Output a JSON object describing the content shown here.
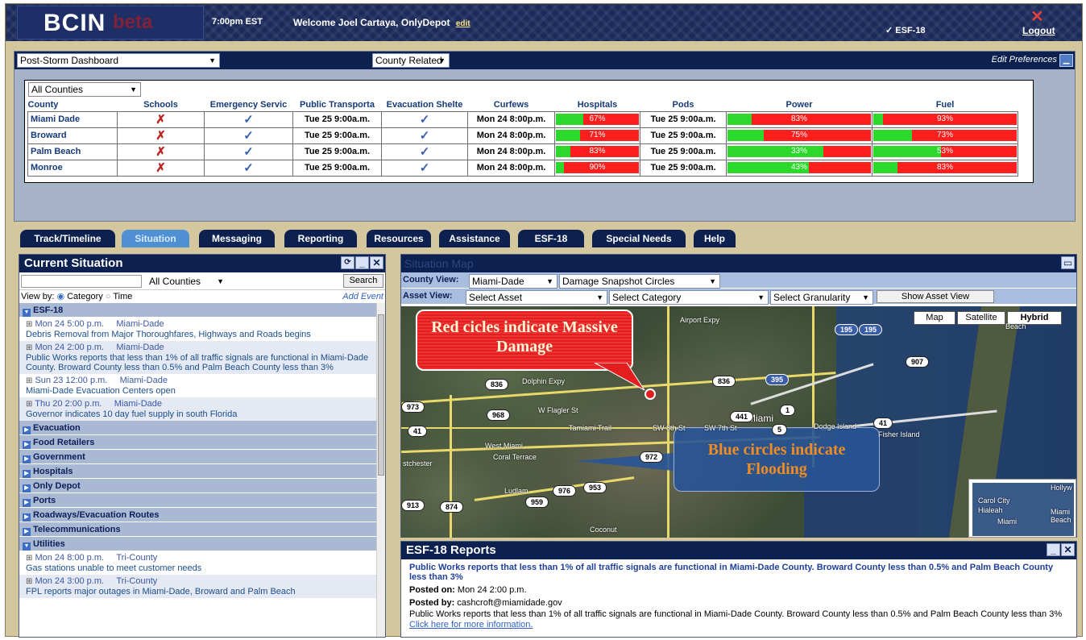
{
  "header": {
    "logo": "BCIN",
    "logo_suffix": "beta",
    "time": "7:00pm EST",
    "welcome": "Welcome Joel Cartaya, OnlyDepot",
    "edit_link": "edit",
    "esf": "✓ ESF-18",
    "logout": "Logout"
  },
  "dashboard": {
    "view_select": "Post-Storm Dashboard",
    "related_select": "County Related",
    "edit_preferences": "Edit Preferences",
    "county_filter": "All Counties",
    "columns": [
      "County",
      "Schools",
      "Emergency Servic",
      "Public Transporta",
      "Evacuation Shelte",
      "Curfews",
      "Hospitals",
      "Pods",
      "Power",
      "Fuel"
    ],
    "rows": [
      {
        "county": "Miami Dade",
        "schools": "✗",
        "emergency": "✓",
        "transport": "Tue 25 9:00a.m.",
        "shelter": "✓",
        "curfew": "Mon 24 8:00p.m.",
        "hospitals": "67%",
        "hospitals_pct": 33,
        "pods": "Tue 25 9:00a.m.",
        "power": "83%",
        "power_pct": 17,
        "fuel": "93%",
        "fuel_pct": 7
      },
      {
        "county": "Broward",
        "schools": "✗",
        "emergency": "✓",
        "transport": "Tue 25 9:00a.m.",
        "shelter": "✓",
        "curfew": "Mon 24 8:00p.m.",
        "hospitals": "71%",
        "hospitals_pct": 29,
        "pods": "Tue 25 9:00a.m.",
        "power": "75%",
        "power_pct": 25,
        "fuel": "73%",
        "fuel_pct": 27
      },
      {
        "county": "Palm Beach",
        "schools": "✗",
        "emergency": "✓",
        "transport": "Tue 25 9:00a.m.",
        "shelter": "✓",
        "curfew": "Mon 24 8:00p.m.",
        "hospitals": "83%",
        "hospitals_pct": 17,
        "pods": "Tue 25 9:00a.m.",
        "power": "33%",
        "power_pct": 67,
        "fuel": "53%",
        "fuel_pct": 47
      },
      {
        "county": "Monroe",
        "schools": "✗",
        "emergency": "✓",
        "transport": "Tue 25 9:00a.m.",
        "shelter": "✓",
        "curfew": "Mon 24 8:00p.m.",
        "hospitals": "90%",
        "hospitals_pct": 10,
        "pods": "Tue 25 9:00a.m.",
        "power": "43%",
        "power_pct": 57,
        "fuel": "83%",
        "fuel_pct": 17
      }
    ]
  },
  "tabs": [
    "Track/Timeline",
    "Situation",
    "Messaging",
    "Reporting",
    "Resources",
    "Assistance",
    "ESF-18",
    "Special Needs",
    "Help"
  ],
  "situation": {
    "title": "Current Situation",
    "county_select": "All Counties",
    "search": "Search",
    "view_by": "View by:",
    "opt_category": "Category",
    "opt_time": "Time",
    "add_event": "Add Event",
    "esf_group": "ESF-18",
    "esf_entries": [
      {
        "time": "Mon 24 5:00 p.m.",
        "loc": "Miami-Dade",
        "text": "Debris Removal from Major Thoroughfares, Highways and Roads begins"
      },
      {
        "time": "Mon 24 2:00 p.m.",
        "loc": "Miami-Dade",
        "text": "Public Works reports that less than 1% of all traffic signals are functional in Miami-Dade County. Broward County less than 0.5% and Palm Beach County less than 3%"
      },
      {
        "time": "Sun 23 12:00 p.m.",
        "loc": "Miami-Dade",
        "text": "Miami-Dade Evacuation Centers open"
      },
      {
        "time": "Thu 20 2:00 p.m.",
        "loc": "Miami-Dade",
        "text": "Governor indicates 10 day fuel supply in south Florida"
      }
    ],
    "categories": [
      "Evacuation",
      "Food Retailers",
      "Government",
      "Hospitals",
      "Only Depot",
      "Ports",
      "Roadways/Evacuation Routes",
      "Telecommunications"
    ],
    "utilities_group": "Utilities",
    "util_entries": [
      {
        "time": "Mon 24 8:00 p.m.",
        "loc": "Tri-County",
        "text": "Gas stations unable to meet customer needs"
      },
      {
        "time": "Mon 24 3:00 p.m.",
        "loc": "Tri-County",
        "text": "FPL reports major outages in Miami-Dade, Broward and Palm Beach"
      }
    ]
  },
  "map": {
    "title": "Situation Map",
    "county_view_label": "County View:",
    "county_view": "Miami-Dade",
    "snapshot": "Damage Snapshot Circles",
    "asset_view_label": "Asset View:",
    "asset": "Select Asset",
    "category": "Select Category",
    "granularity": "Select Granularity",
    "show_asset": "Show Asset View",
    "btn_map": "Map",
    "btn_satellite": "Satellite",
    "btn_hybrid": "Hybrid",
    "red_callout": "Red cicles indicate Massive Damage",
    "blue_callout": "Blue circles indicate Flooding",
    "labels": {
      "miami": "Miami",
      "west_miami": "West Miami",
      "coral_terrace": "Coral Terrace",
      "ludlam": "Ludlam",
      "coconut": "Coconut",
      "sw8": "SW 8th St",
      "sw7": "SW 7th St",
      "tamiami": "Tamiami Trail",
      "flagler": "W Flagler St",
      "dodge": "Dodge Island",
      "fisher": "Fisher Island",
      "beach": "Beach",
      "stchester": "stchester",
      "hollyw": "Hollyw",
      "carol": "Carol City",
      "hialeah": "Hialeah",
      "miami_beach": "Miami Beach",
      "inset_miami": "Miami",
      "dolphin": "Dolphin Expy",
      "airport": "Airport Expy"
    },
    "shields": [
      "836",
      "968",
      "973",
      "41",
      "972",
      "976",
      "953",
      "959",
      "913",
      "874",
      "195",
      "195",
      "907",
      "836",
      "395",
      "441",
      "1",
      "5",
      "41"
    ]
  },
  "reports": {
    "title": "ESF-18 Reports",
    "headline": "Public Works reports that less than 1% of all traffic signals are functional in Miami-Dade County. Broward County less than 0.5% and Palm Beach County less than 3%",
    "posted_on_label": "Posted on:",
    "posted_on": "Mon 24 2:00 p.m.",
    "posted_by_label": "Posted by:",
    "posted_by": "cashcroft@miamidade.gov",
    "body": "Public Works reports that less than 1% of all traffic signals are functional in Miami-Dade County. Broward County less than 0.5% and Palm Beach County less than 3%",
    "more": "Click here for more information."
  },
  "colors": {
    "navy": "#0d2150",
    "red": "#ff1e1e",
    "green": "#2bd82b",
    "tan": "#d4c79e"
  }
}
